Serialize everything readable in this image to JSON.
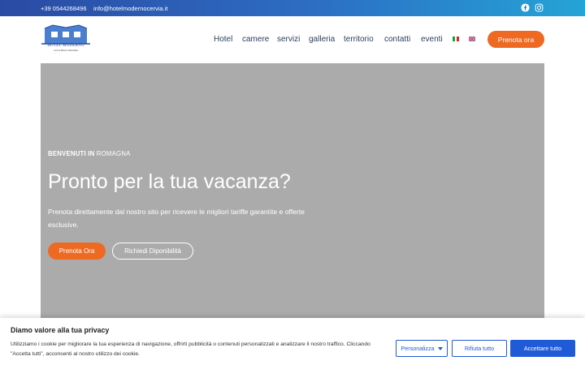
{
  "topbar": {
    "phone": "+39 0544268496",
    "email": "info@hotelmodernocervia.it",
    "facebook_icon": "facebook-icon",
    "instagram_icon": "instagram-icon"
  },
  "logo": {
    "name": "HOTEL MODERNO",
    "sub": "Cervia Milano Marittima"
  },
  "nav": {
    "items": [
      "Hotel",
      "camere",
      "servizi",
      "galleria",
      "territorio",
      "contatti",
      "eventi"
    ],
    "flags": [
      "it-flag-icon",
      "en-flag-icon"
    ],
    "book_label": "Prenota ora"
  },
  "hero": {
    "eyebrow_bold": "BENVENUTI IN",
    "eyebrow_rest": " ROMAGNA",
    "title": "Pronto per la tua vacanza?",
    "text": "Prenota direttamente dal nostro sito per ricevere le migliori tariffe garantite e offerte esclusive.",
    "btn_primary": "Prenota Ora",
    "btn_secondary": "Richiedi Diponibilità"
  },
  "cookie": {
    "title": "Diamo valore alla tua privacy",
    "text": "Utilizziamo i cookie per migliorare la tua esperienza di navigazione, offrirti pubblicità o contenuti personalizzati e analizzare il nostro traffico. Cliccando \"Accetta tutti\", acconsenti al nostro utilizzo dei cookie.",
    "btn_personalize": "Personalizza",
    "btn_reject": "Rifiuta tutto",
    "btn_accept": "Accettare tutto"
  },
  "colors": {
    "accent_orange": "#ee6a22",
    "cookie_blue": "#1f5bd6",
    "hero_gray": "#ababab",
    "topbar_start": "#2b4aa3",
    "topbar_end": "#25a4d6"
  }
}
